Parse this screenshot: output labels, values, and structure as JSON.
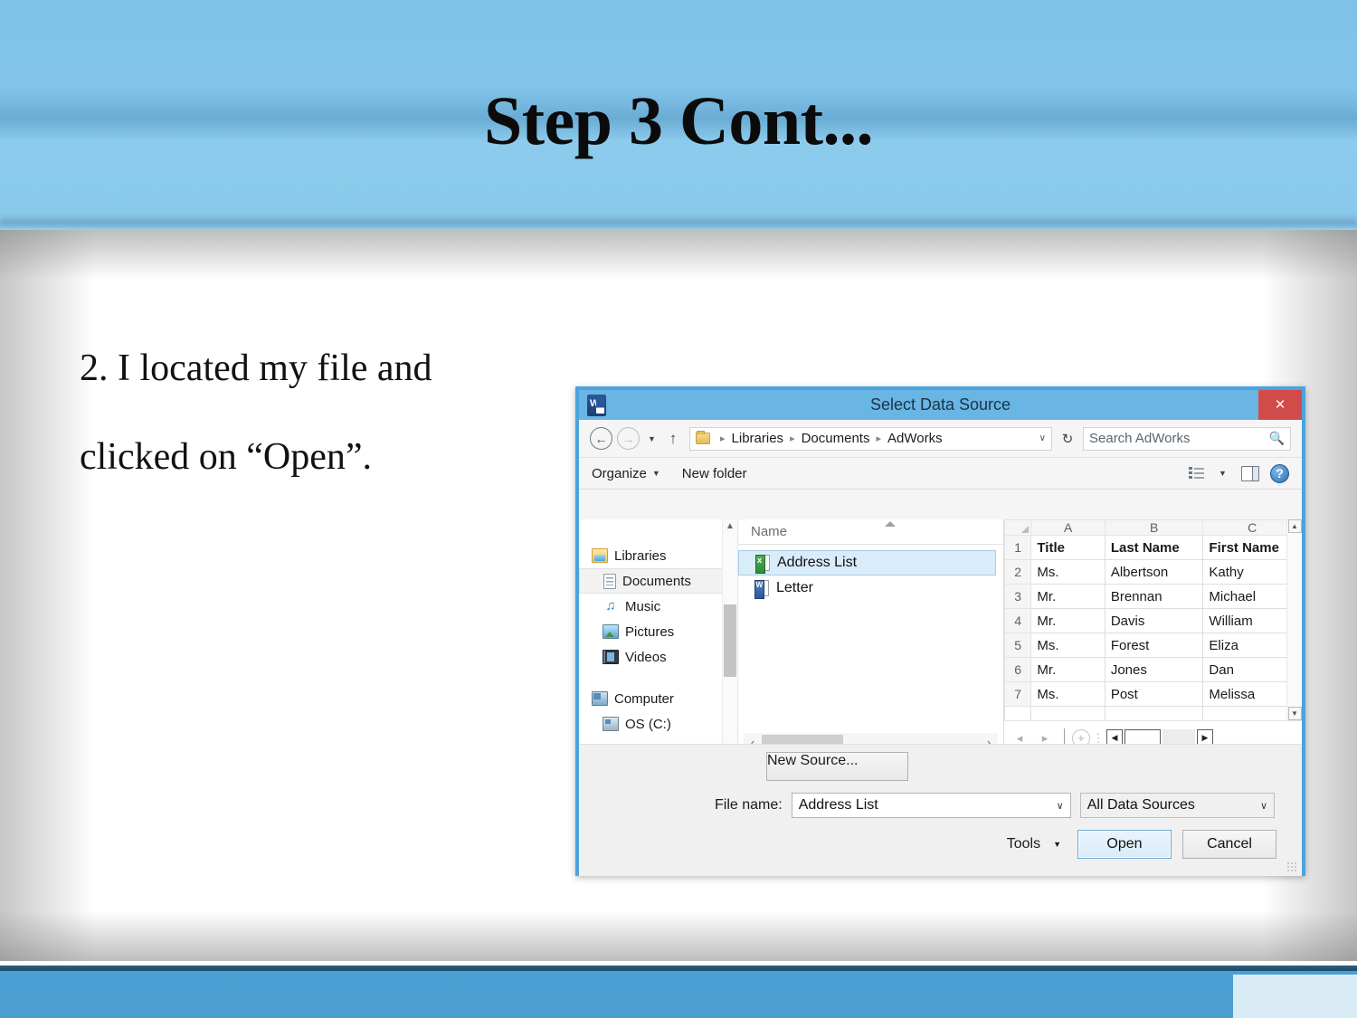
{
  "slide": {
    "title": "Step 3 Cont...",
    "body_line1": "2.  I  located  my  file  and",
    "body_line2": "clicked on “Open”."
  },
  "dialog": {
    "title": "Select Data Source",
    "app_icon": "word-icon",
    "close_label": "×",
    "nav": {
      "back": "←",
      "forward": "→",
      "history_caret": "▼",
      "up": "↑",
      "refresh": "↻",
      "address_caret": "∨",
      "breadcrumbs": [
        "Libraries",
        "Documents",
        "AdWorks"
      ],
      "separator": "▸"
    },
    "search": {
      "placeholder": "Search AdWorks",
      "icon": "search-icon"
    },
    "toolbar": {
      "organize": "Organize",
      "organize_caret": "▼",
      "new_folder": "New folder",
      "view_caret": "▼",
      "help_glyph": "?"
    },
    "sidebar": {
      "items": [
        {
          "label": "Libraries",
          "icon": "libraries-icon",
          "indent": false,
          "selected": false
        },
        {
          "label": "Documents",
          "icon": "documents-icon",
          "indent": true,
          "selected": true
        },
        {
          "label": "Music",
          "icon": "music-icon",
          "indent": true,
          "selected": false
        },
        {
          "label": "Pictures",
          "icon": "pictures-icon",
          "indent": true,
          "selected": false
        },
        {
          "label": "Videos",
          "icon": "videos-icon",
          "indent": true,
          "selected": false
        },
        {
          "label": "Computer",
          "icon": "computer-icon",
          "indent": false,
          "selected": false
        },
        {
          "label": "OS (C:)",
          "icon": "drive-icon",
          "indent": true,
          "selected": false
        }
      ]
    },
    "filelist": {
      "column_header": "Name",
      "items": [
        {
          "label": "Address List",
          "icon": "excel-file-icon",
          "selected": true
        },
        {
          "label": "Letter",
          "icon": "word-file-icon",
          "selected": false
        }
      ],
      "scroll_left": "‹",
      "scroll_right": "›"
    },
    "preview": {
      "sheet_prev": "◂",
      "sheet_next": "▸",
      "add_sheet": "+",
      "more_dots": "⋮",
      "scroll_left": "◀",
      "scroll_right": "▶",
      "scroll_up": "▲",
      "scroll_down": "▼"
    },
    "footer": {
      "new_source": "New Source...",
      "file_name_label": "File name:",
      "file_name_value": "Address List",
      "file_type_value": "All Data Sources",
      "tools": "Tools",
      "tools_caret": "▼",
      "open": "Open",
      "cancel": "Cancel",
      "combo_caret": "∨"
    }
  },
  "chart_data": {
    "type": "table",
    "title": "Address List preview",
    "column_letters": [
      "A",
      "B",
      "C"
    ],
    "columns": [
      "Title",
      "Last Name",
      "First Name"
    ],
    "row_numbers": [
      1,
      2,
      3,
      4,
      5,
      6,
      7
    ],
    "rows": [
      [
        "Title",
        "Last Name",
        "First Name"
      ],
      [
        "Ms.",
        "Albertson",
        "Kathy"
      ],
      [
        "Mr.",
        "Brennan",
        "Michael"
      ],
      [
        "Mr.",
        "Davis",
        "William"
      ],
      [
        "Ms.",
        "Forest",
        "Eliza"
      ],
      [
        "Mr.",
        "Jones",
        "Dan"
      ],
      [
        "Ms.",
        "Post",
        "Melissa"
      ]
    ]
  },
  "colors": {
    "header_blue": "#83c5ea",
    "footer_blue": "#4c9fd2",
    "dialog_border": "#4aa3dd",
    "titlebar": "#69b5e4",
    "close_red": "#d24b4b",
    "selection_blue": "#d9ecf9",
    "footer_tab": "#d9ecf6"
  }
}
